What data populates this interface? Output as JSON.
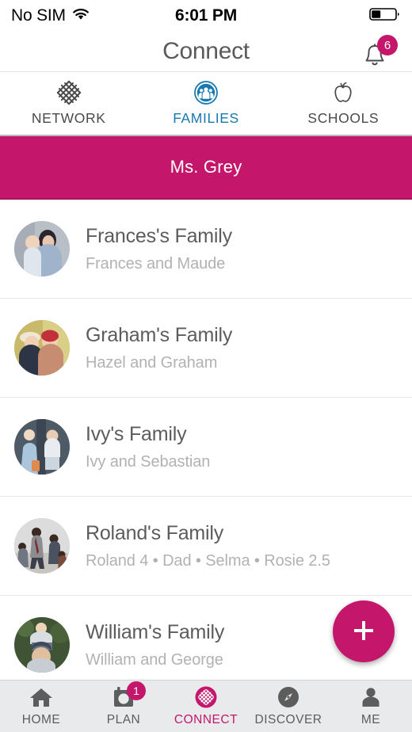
{
  "status_bar": {
    "carrier": "No SIM",
    "wifi_icon": "wifi-icon",
    "time": "6:01 PM",
    "battery_icon": "battery-icon",
    "battery_level_percent": 35
  },
  "navbar": {
    "title": "Connect",
    "notifications_icon": "bell-icon",
    "notifications_badge": "6"
  },
  "segmented_tabs": {
    "items": [
      {
        "label": "NETWORK",
        "icon": "network-lattice-icon",
        "active": false
      },
      {
        "label": "FAMILIES",
        "icon": "families-group-icon",
        "active": true
      },
      {
        "label": "SCHOOLS",
        "icon": "apple-icon",
        "active": false
      }
    ],
    "active_color": "#1878b0",
    "inactive_color": "#4a4a4a"
  },
  "teacher_banner": {
    "name": "Ms. Grey",
    "background_color": "#C4176C",
    "text_color": "#FFFFFF"
  },
  "families": [
    {
      "title": "Frances's Family",
      "members": "Frances and Maude",
      "avatar": "photo-mother-and-baby"
    },
    {
      "title": "Graham's Family",
      "members": "Hazel and Graham",
      "avatar": "photo-woman-and-child-autumn"
    },
    {
      "title": "Ivy's Family",
      "members": "Ivy and Sebastian",
      "avatar": "photo-two-children"
    },
    {
      "title": "Roland's Family",
      "members": "Roland 4 • Dad • Selma • Rosie 2.5",
      "avatar": "photo-family-walking"
    },
    {
      "title": "William's Family",
      "members": "William and George",
      "avatar": "photo-father-and-child"
    }
  ],
  "fab": {
    "icon": "plus-icon",
    "label": "Add",
    "color": "#C4176C"
  },
  "bottom_tabs": {
    "items": [
      {
        "label": "HOME",
        "icon": "home-icon",
        "active": false,
        "badge": ""
      },
      {
        "label": "PLAN",
        "icon": "calendar-icon",
        "active": false,
        "badge": "1"
      },
      {
        "label": "CONNECT",
        "icon": "connect-lattice-circle-icon",
        "active": true,
        "badge": ""
      },
      {
        "label": "DISCOVER",
        "icon": "compass-icon",
        "active": false,
        "badge": ""
      },
      {
        "label": "ME",
        "icon": "person-icon",
        "active": false,
        "badge": ""
      }
    ],
    "active_color": "#C4176C",
    "inactive_color": "#5d5d5d"
  }
}
